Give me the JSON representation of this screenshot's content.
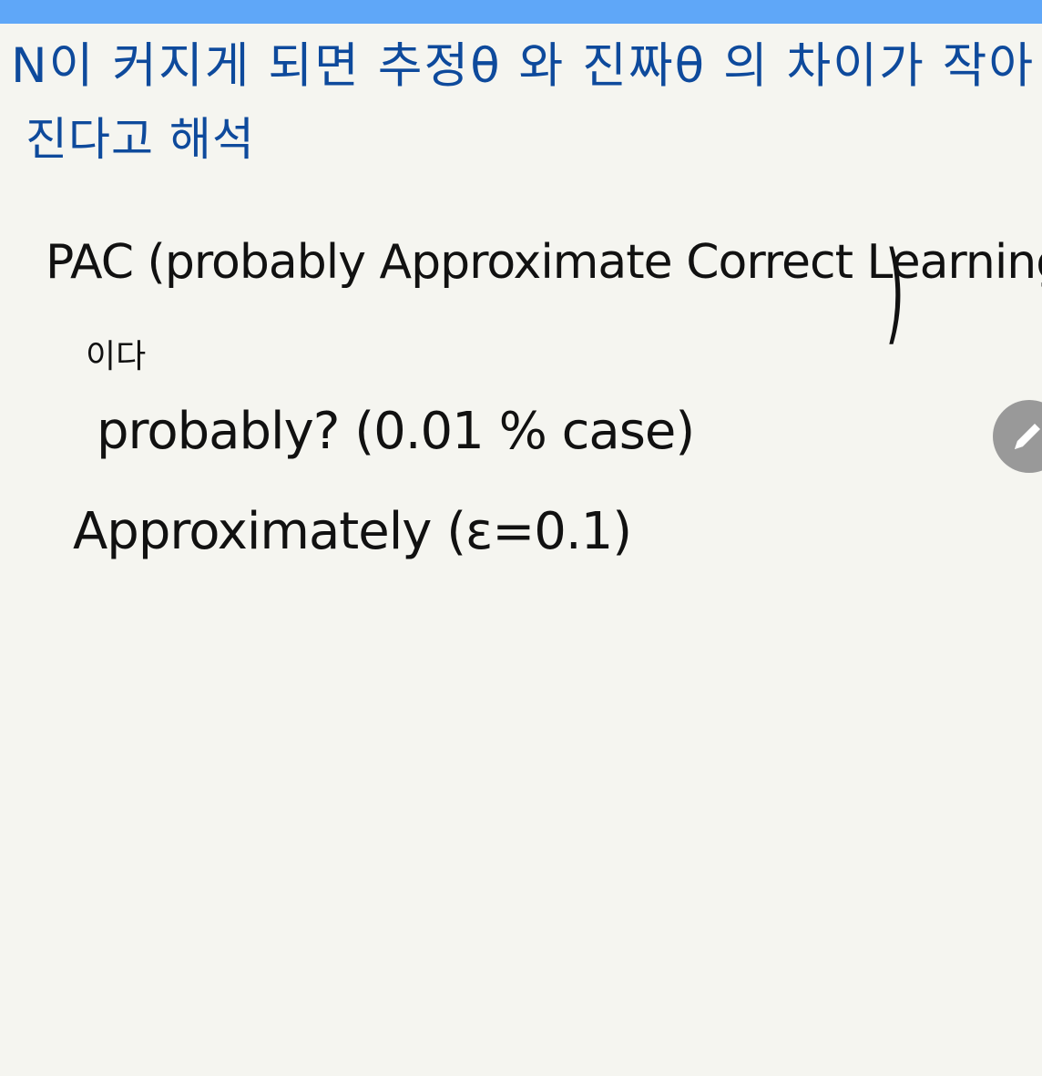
{
  "colors": {
    "top_bar": "#5fa7f8",
    "background": "#f5f5f0",
    "blue_ink": "#0e4a9c",
    "black_ink": "#111111",
    "pen_button": "#999999"
  },
  "note": {
    "line1": "N이 커지게 되면  추정θ 와 진짜θ 의 차이가 작아",
    "line2": "진다고 해석",
    "line3": "PAC (probably Approximate Correct Learning",
    "line4": "이다",
    "line5": "probably? (0.01 % case)",
    "line6": "Approximately (ε=0.1)",
    "closing_paren": ")"
  },
  "pen_button": {
    "icon": "pencil-icon"
  }
}
